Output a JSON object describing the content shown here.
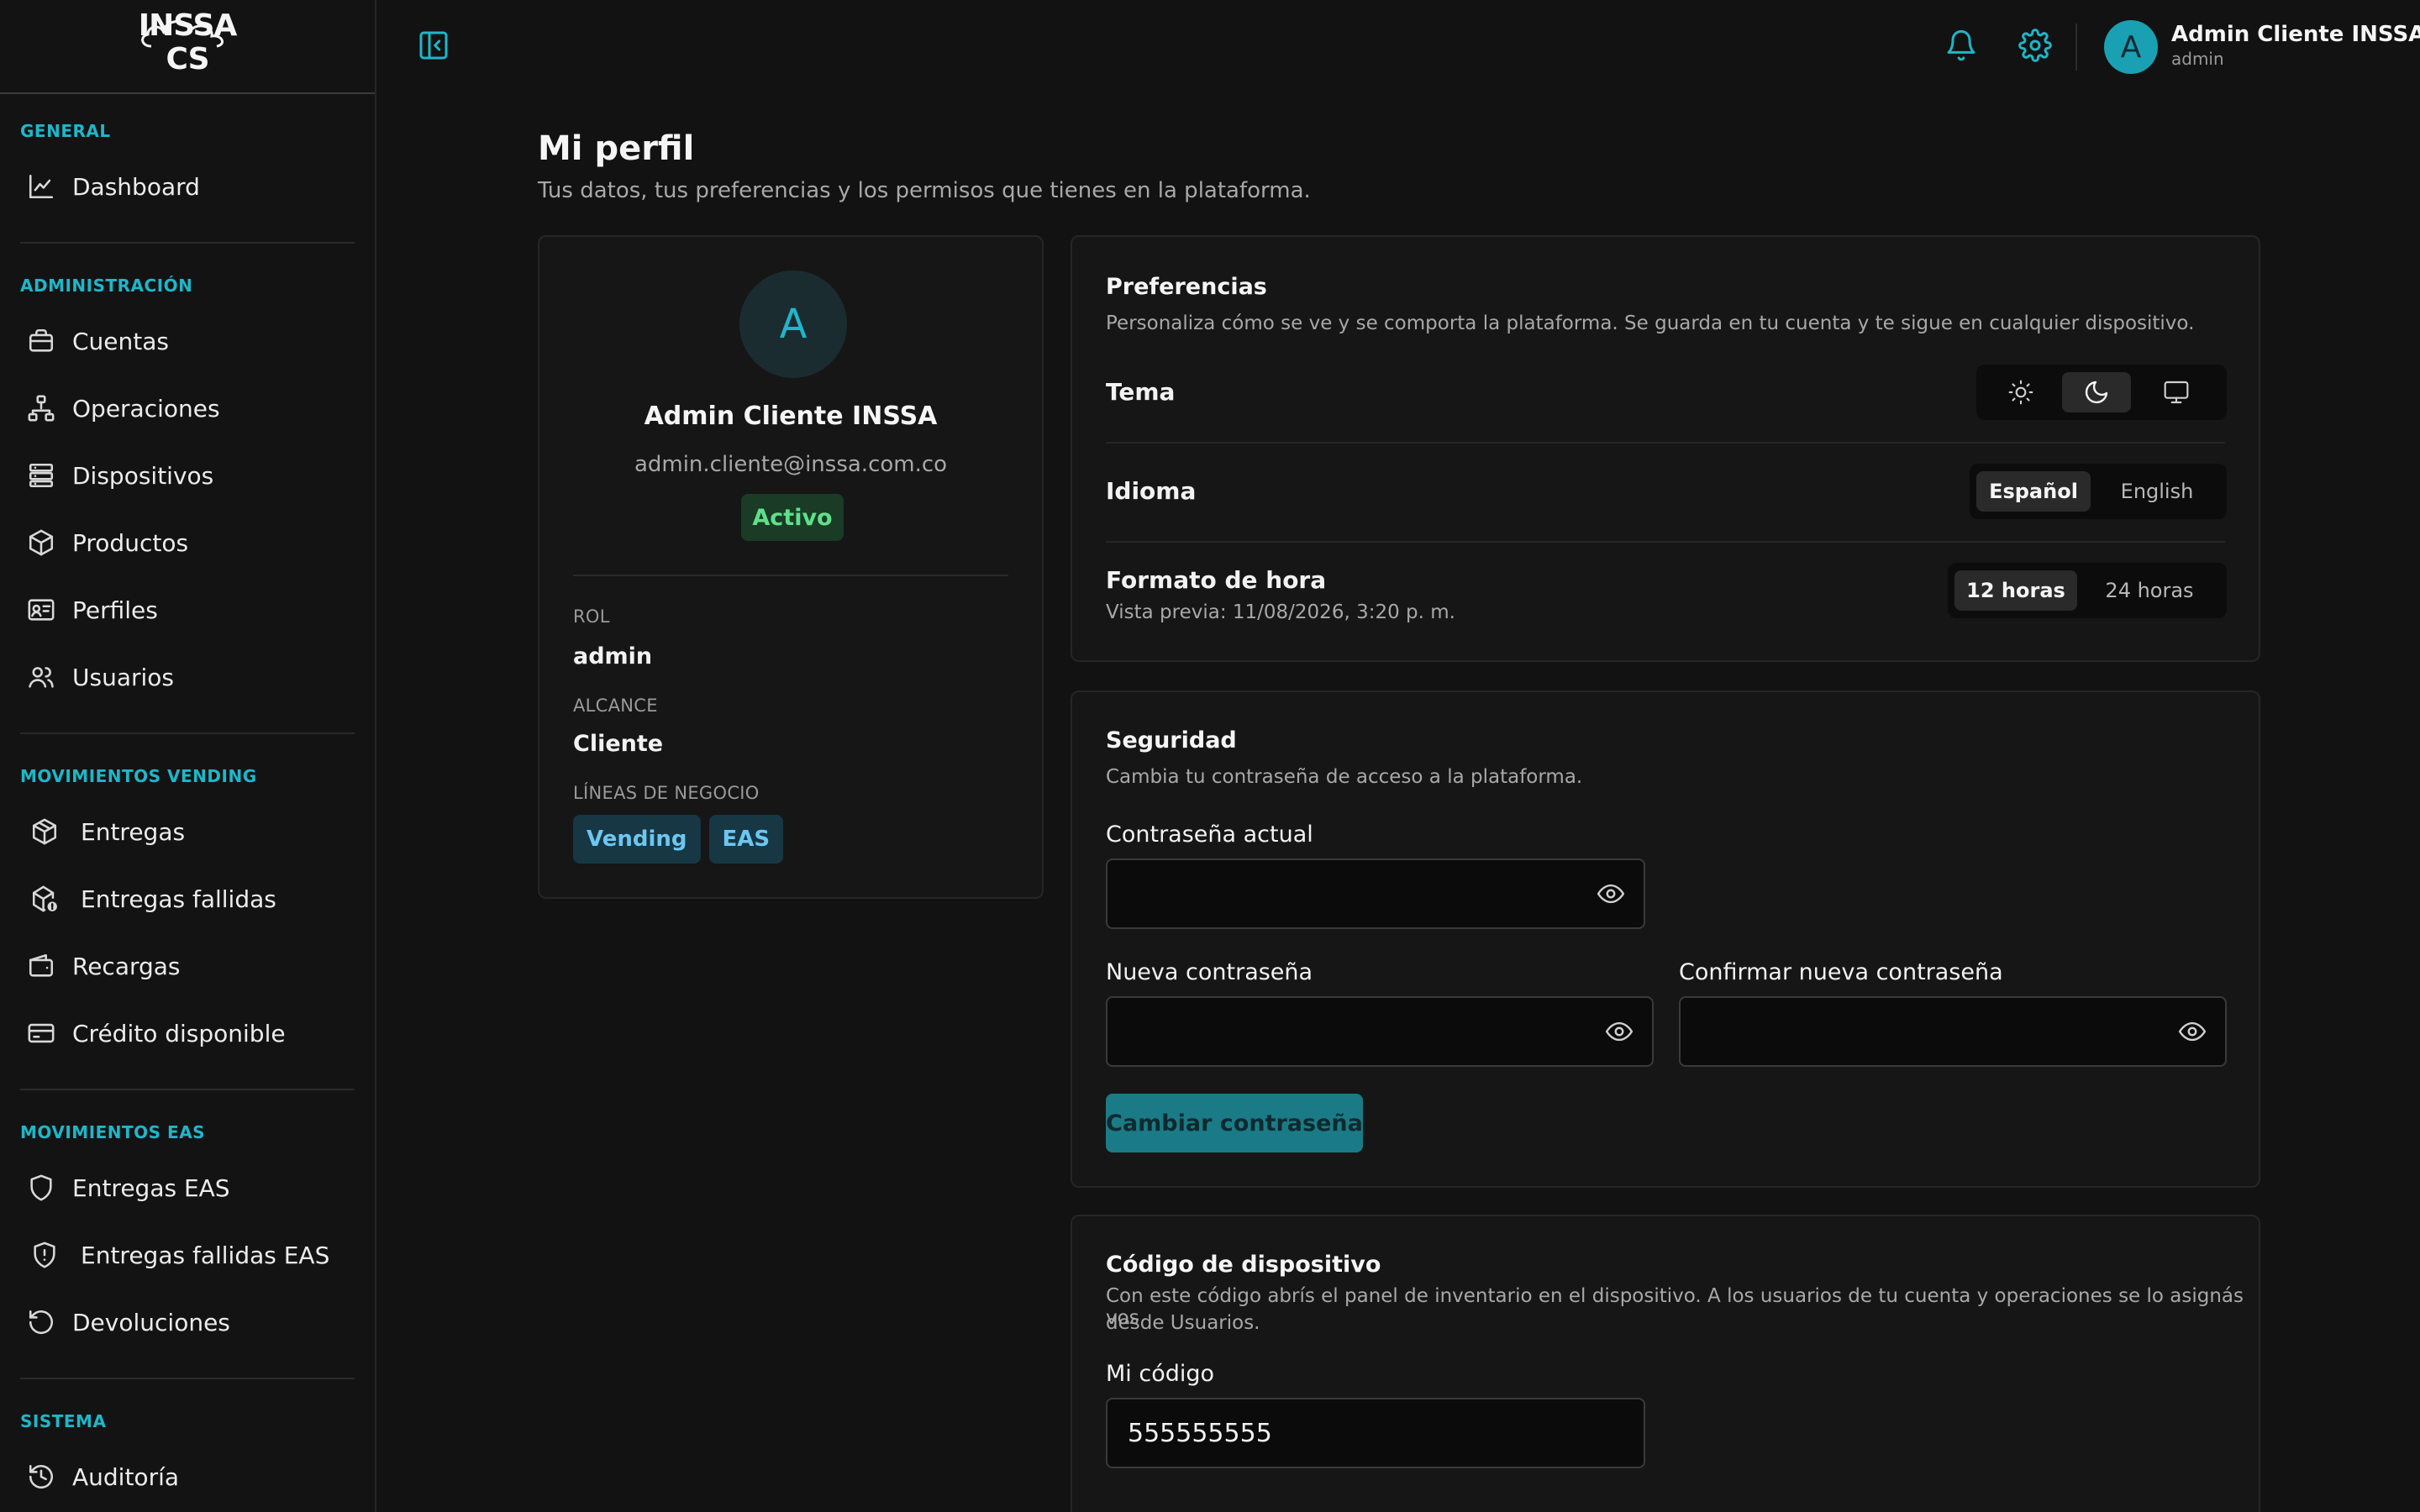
{
  "brand": {
    "logo_text": "INSSA CS"
  },
  "sidebar": {
    "sections": [
      {
        "label": "GENERAL",
        "items": [
          {
            "label": "Dashboard",
            "icon": "chart-line-icon"
          }
        ]
      },
      {
        "label": "ADMINISTRACIÓN",
        "items": [
          {
            "label": "Cuentas",
            "icon": "briefcase-icon"
          },
          {
            "label": "Operaciones",
            "icon": "network-icon"
          },
          {
            "label": "Dispositivos",
            "icon": "server-icon"
          },
          {
            "label": "Productos",
            "icon": "box-icon"
          },
          {
            "label": "Perfiles",
            "icon": "id-card-icon"
          },
          {
            "label": "Usuarios",
            "icon": "users-icon"
          }
        ]
      },
      {
        "label": "MOVIMIENTOS VENDING",
        "items": [
          {
            "label": "Entregas",
            "icon": "package-icon"
          },
          {
            "label": "Entregas fallidas",
            "icon": "package-alert-icon"
          },
          {
            "label": "Recargas",
            "icon": "wallet-icon"
          },
          {
            "label": "Crédito disponible",
            "icon": "credit-card-icon"
          }
        ]
      },
      {
        "label": "MOVIMIENTOS EAS",
        "items": [
          {
            "label": "Entregas EAS",
            "icon": "shield-icon"
          },
          {
            "label": "Entregas fallidas EAS",
            "icon": "shield-alert-icon"
          },
          {
            "label": "Devoluciones",
            "icon": "rotate-ccw-icon"
          }
        ]
      },
      {
        "label": "SISTEMA",
        "items": [
          {
            "label": "Auditoría",
            "icon": "history-icon"
          }
        ]
      }
    ]
  },
  "topbar": {
    "user_initial": "A",
    "user_name": "Admin Cliente INSSA",
    "user_role": "admin",
    "icons": [
      "bell-icon",
      "gear-icon"
    ]
  },
  "page": {
    "title": "Mi perfil",
    "subtitle": "Tus datos, tus preferencias y los permisos que tienes en la plataforma."
  },
  "profile": {
    "initial": "A",
    "name": "Admin Cliente INSSA",
    "email": "admin.cliente@inssa.com.co",
    "status": "Activo",
    "role_label": "ROL",
    "role_value": "admin",
    "scope_label": "ALCANCE",
    "scope_value": "Cliente",
    "lines_label": "LÍNEAS DE NEGOCIO",
    "lines": [
      "Vending",
      "EAS"
    ]
  },
  "preferences": {
    "title": "Preferencias",
    "description": "Personaliza cómo se ve y se comporta la plataforma. Se guarda en tu cuenta y te sigue en cualquier dispositivo.",
    "theme_label": "Tema",
    "theme_options": [
      "sun-icon",
      "moon-icon",
      "monitor-icon"
    ],
    "theme_selected": "moon-icon",
    "language_label": "Idioma",
    "language_options": [
      "Español",
      "English"
    ],
    "language_selected": "Español",
    "time_label": "Formato de hora",
    "time_preview": "Vista previa: 11/08/2026, 3:20 p. m.",
    "time_options": [
      "12 horas",
      "24 horas"
    ],
    "time_selected": "12 horas"
  },
  "security": {
    "title": "Seguridad",
    "description": "Cambia tu contraseña de acceso a la plataforma.",
    "current_label": "Contraseña actual",
    "current_value": "",
    "new_label": "Nueva contraseña",
    "new_value": "",
    "confirm_label": "Confirmar nueva contraseña",
    "confirm_value": "",
    "submit_label": "Cambiar contraseña"
  },
  "device_code": {
    "title": "Código de dispositivo",
    "description_line1": "Con este código abrís el panel de inventario en el dispositivo. A los usuarios de tu cuenta y operaciones se lo asignás vos",
    "description_line2": "desde Usuarios.",
    "code_label": "Mi código",
    "code_value": "555555555"
  },
  "colors": {
    "accent": "#1fb6c9",
    "background": "#121212",
    "card": "#161616",
    "success": "#5fe08a",
    "chip": "#6cc6f0"
  }
}
